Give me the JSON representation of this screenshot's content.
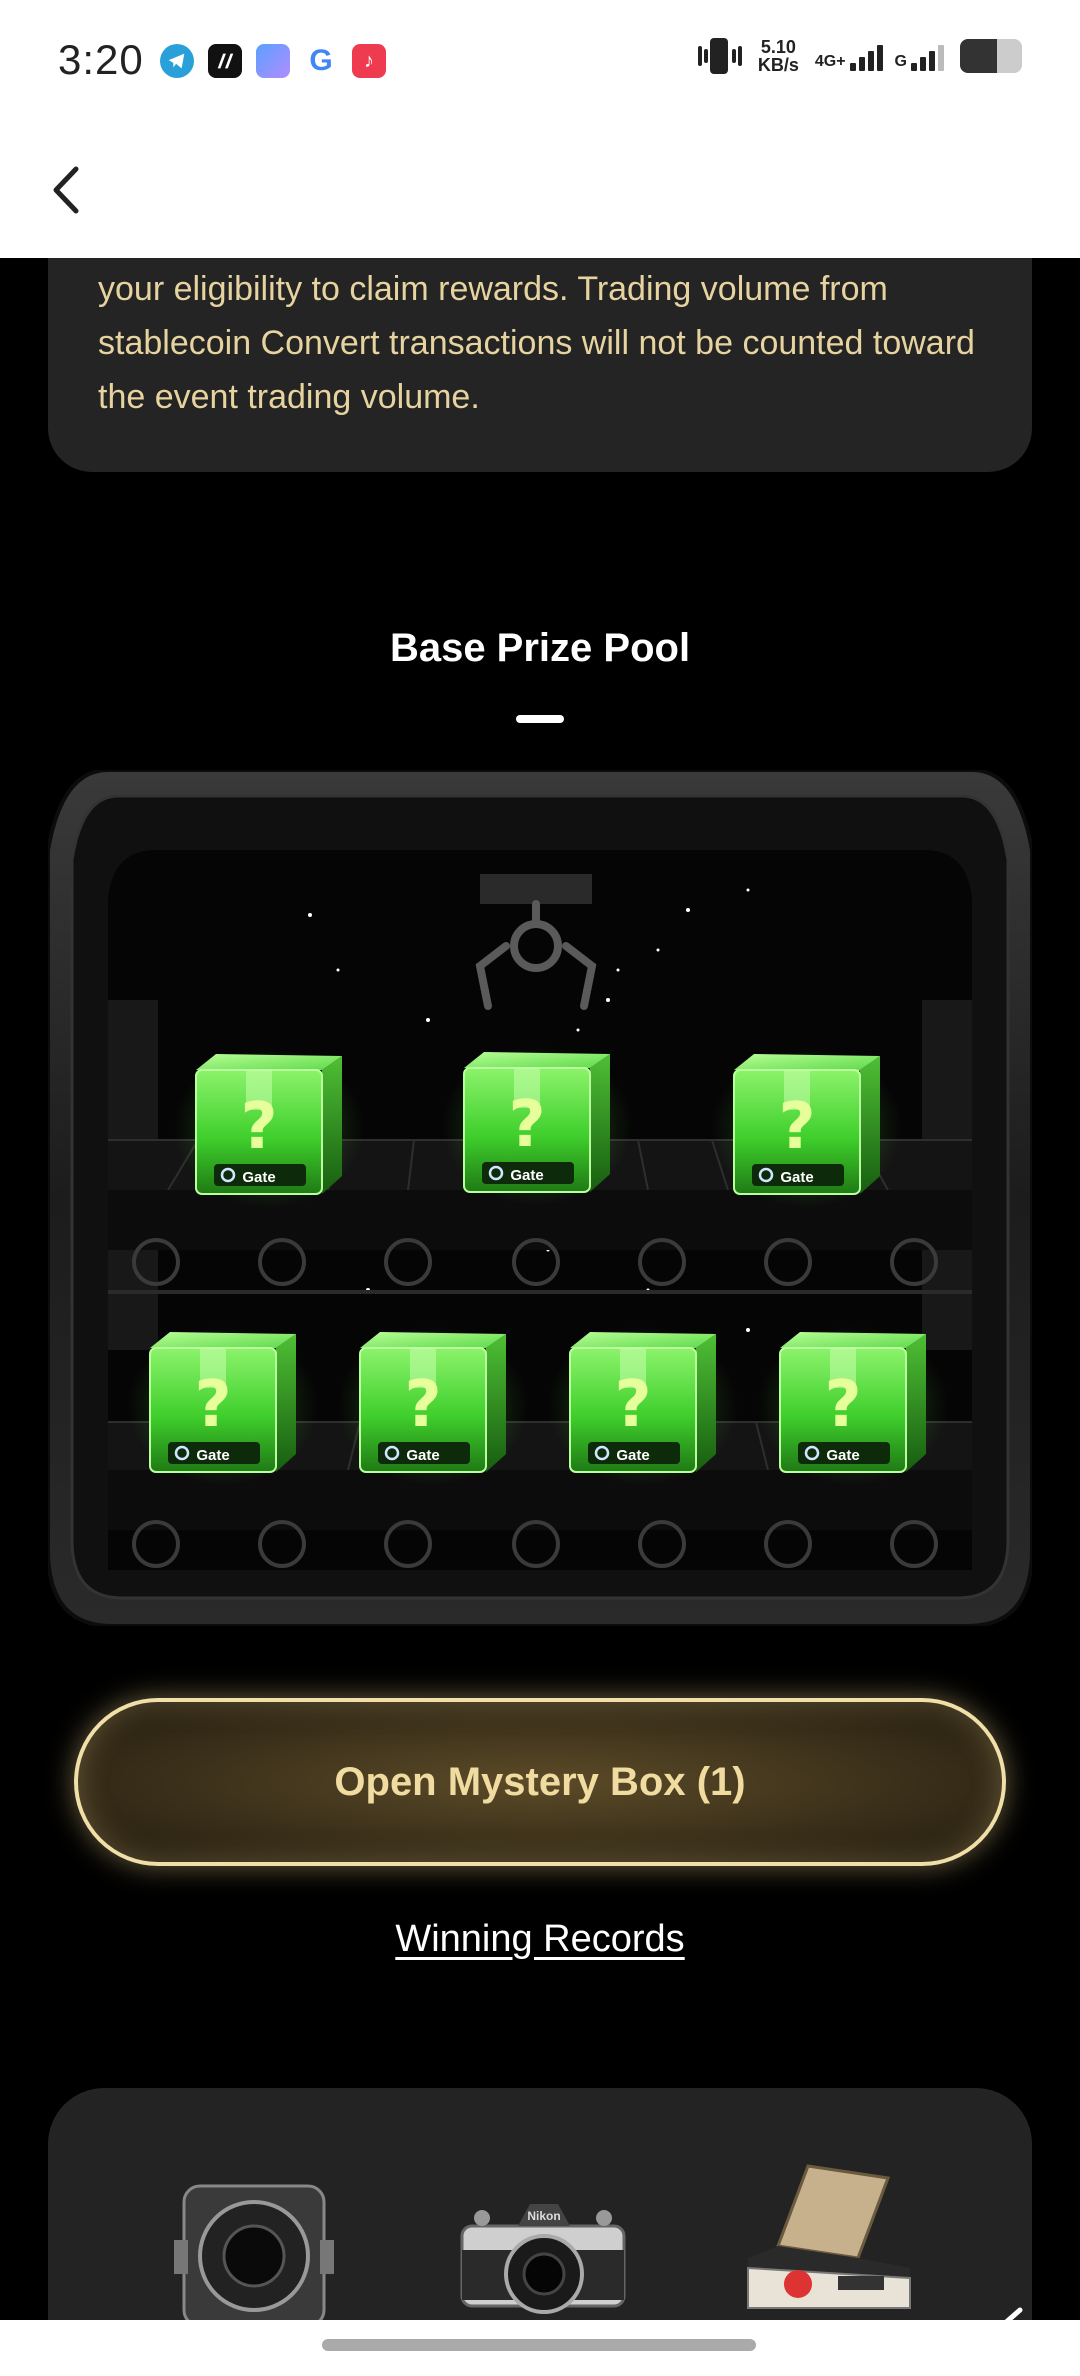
{
  "status_bar": {
    "time": "3:20",
    "net_speed_value": "5.10",
    "net_speed_unit": "KB/s",
    "network_type": "4G+",
    "network_type_2": "G",
    "icons": [
      "telegram-icon",
      "app-icon",
      "files-icon",
      "google-icon",
      "music-icon",
      "vibrate-icon",
      "signal-icon",
      "battery-icon"
    ]
  },
  "nav": {
    "back_icon": "chevron-left-icon"
  },
  "notice": {
    "text": "your eligibility to claim rewards. Trading volume from stablecoin Convert transactions will not be counted toward the event trading volume."
  },
  "pool": {
    "title": "Base Prize Pool",
    "box_label": "Gate",
    "box_mark": "?",
    "top_row_count": 3,
    "bottom_row_count": 4
  },
  "actions": {
    "open_box": "Open Mystery Box (1)",
    "records": "Winning Records"
  },
  "prizes": {
    "items": [
      "medium-format-camera",
      "nikon-camera",
      "polaroid-camera"
    ],
    "nikon_label": "Nikon"
  },
  "colors": {
    "background": "#000000",
    "card": "#242424",
    "notice_text": "#e6d39f",
    "gold": "#f0dba0",
    "box_green": "#5ee04a"
  }
}
